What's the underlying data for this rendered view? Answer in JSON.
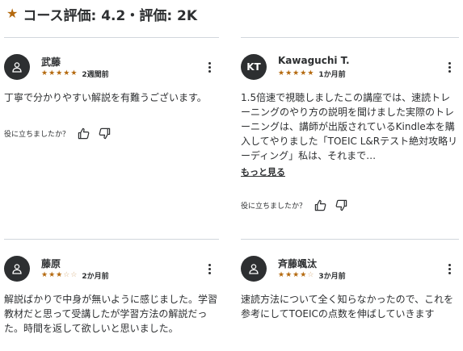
{
  "header": {
    "star_icon": "star-icon",
    "title": "コース評価: 4.2・評価: 2K"
  },
  "reviews": [
    {
      "name": "武藤",
      "avatar_type": "person-icon",
      "rating": 5,
      "time": "2週間前",
      "text": "丁寧で分かりやすい解説を有難うございます。",
      "show_more": "",
      "helpful_label": "役に立ちましたか？"
    },
    {
      "name": "Kawaguchi T.",
      "avatar_type": "initials",
      "initials": "KT",
      "rating": 5,
      "time": "1か月前",
      "text": "1.5倍速で視聴しましたこの講座では、速読トレーニングのやり方の説明を聞けました実際のトレーニングは、講師が出版されているKindle本を購入してやりました「TOEIC L&Rテスト絶対攻略リーディング」私は、それまで…",
      "show_more": "もっと見る",
      "helpful_label": "役に立ちましたか？"
    },
    {
      "name": "藤原",
      "avatar_type": "person-icon",
      "rating": 3,
      "time": "2か月前",
      "text": "解説ばかりで中身が無いように感じました。学習教材だと思って受講したが学習方法の解説だった。時間を返して欲しいと思いました。",
      "show_more": "",
      "helpful_label": ""
    },
    {
      "name": "斉藤颯汰",
      "avatar_type": "person-icon",
      "rating": 4,
      "time": "3か月前",
      "text": "速読方法について全く知らなかったので、これを参考にしてTOEICの点数を伸ばしていきます",
      "show_more": "",
      "helpful_label": ""
    }
  ],
  "colors": {
    "star": "#b4690e",
    "text": "#2d2f31",
    "divider": "#d1d7dc",
    "avatar_bg": "#2d2f31"
  }
}
